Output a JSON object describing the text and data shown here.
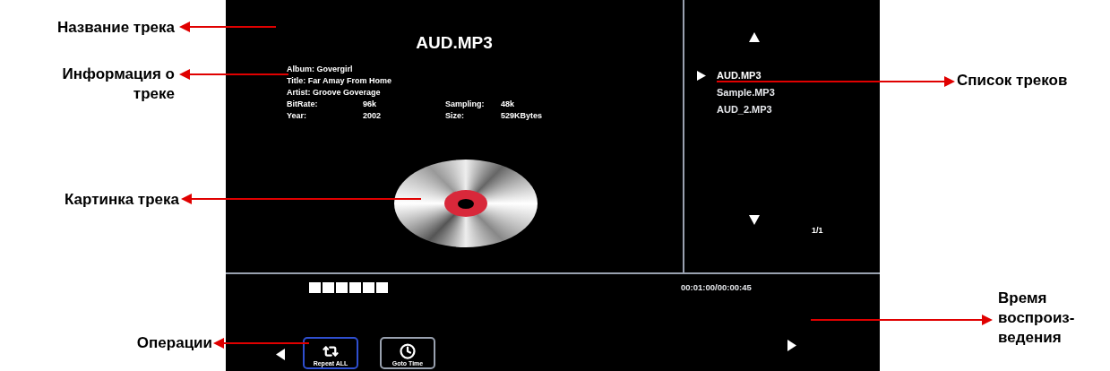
{
  "annotations": [
    {
      "kind": "left",
      "text": "Название трека"
    },
    {
      "kind": "left",
      "text": "Информация о\nтреке"
    },
    {
      "kind": "left",
      "text": "Картинка трека"
    },
    {
      "kind": "left",
      "text": "Операции"
    },
    {
      "kind": "right",
      "text": "Список треков"
    },
    {
      "kind": "right",
      "text": "Время\nвоспроиз-\nведения"
    }
  ],
  "player": {
    "title": "AUD.MP3",
    "info": [
      {
        "label": "Album:",
        "value": "Govergirl"
      },
      {
        "label": "Title:",
        "value": "Far Amay From Home"
      },
      {
        "label": "Artist:",
        "value": "Groove Goverage"
      },
      {
        "label": "BitRate:",
        "value": "96k",
        "label_2": "Sampling:",
        "value_2": "48k"
      },
      {
        "label": "Year:",
        "value": "2002",
        "label_2": "Size:",
        "value_2": "529KBytes"
      }
    ],
    "tracks": [
      {
        "name": "AUD.MP3",
        "selected": true
      },
      {
        "name": "Sample.MP3",
        "selected": false
      },
      {
        "name": "AUD_2.MP3",
        "selected": false
      }
    ],
    "page": "1/1",
    "time": "00:01:00/00:00:45",
    "buttons": [
      {
        "kind": "repeat",
        "label": "Repeat ALL",
        "selected": true
      },
      {
        "kind": "goto",
        "label": "Goto Time",
        "selected": false
      }
    ]
  }
}
